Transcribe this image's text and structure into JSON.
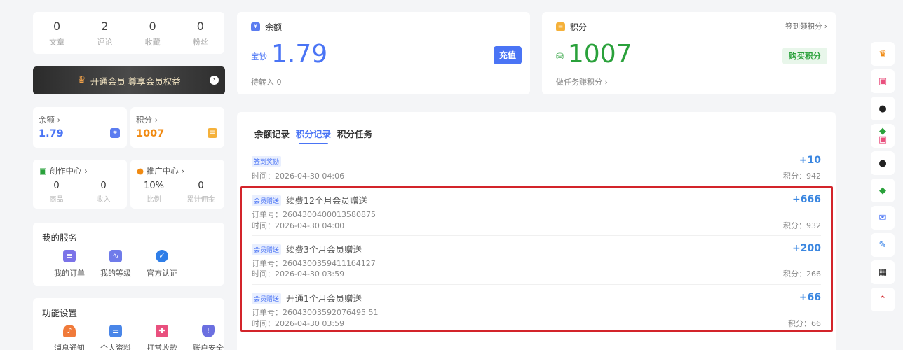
{
  "stats": [
    {
      "value": "0",
      "label": "文章"
    },
    {
      "value": "2",
      "label": "评论"
    },
    {
      "value": "0",
      "label": "收藏"
    },
    {
      "value": "0",
      "label": "粉丝"
    }
  ],
  "vip_banner": {
    "text": "开通会员 尊享会员权益"
  },
  "mini_cards": {
    "balance": {
      "title": "余额 ›",
      "value": "1.79"
    },
    "points": {
      "title": "积分 ›",
      "value": "1007"
    }
  },
  "creator_center": {
    "title": "创作中心 ›",
    "cols": [
      {
        "value": "0",
        "label": "商品"
      },
      {
        "value": "0",
        "label": "收入"
      }
    ]
  },
  "promo_center": {
    "title": "推广中心 ›",
    "cols": [
      {
        "value": "10%",
        "label": "比例"
      },
      {
        "value": "0",
        "label": "累计佣金"
      }
    ]
  },
  "my_services": {
    "title": "我的服务",
    "items": [
      "我的订单",
      "我的等级",
      "官方认证"
    ]
  },
  "settings": {
    "title": "功能设置",
    "items": [
      "消息通知",
      "个人资料",
      "打赏收款",
      "账户安全"
    ]
  },
  "balance_card": {
    "title": "余额",
    "prefix": "宝钞",
    "amount": "1.79",
    "pending": "待转入 0",
    "button": "充值"
  },
  "points_card": {
    "title": "积分",
    "link": "签到领积分 ›",
    "amount": "1007",
    "tasks": "做任务赚积分 ›",
    "button": "购买积分"
  },
  "tabs": [
    "余额记录",
    "积分记录",
    "积分任务"
  ],
  "active_tab": 1,
  "records": [
    {
      "badge": "签到奖励",
      "desc": "",
      "amount": "+10",
      "order": "",
      "time": "时间：2026-04-30 04:06",
      "balance": "积分：942"
    },
    {
      "badge": "会员赠送",
      "desc": "续费12个月会员赠送",
      "amount": "+666",
      "order": "订单号：2604300400013580875",
      "time": "时间：2026-04-30 04:00",
      "balance": "积分：932"
    },
    {
      "badge": "会员赠送",
      "desc": "续费3个月会员赠送",
      "amount": "+200",
      "order": "订单号：26043003594111б4127",
      "time": "时间：2026-04-30 03:59",
      "balance": "积分：266"
    },
    {
      "badge": "会员赠送",
      "desc": "开通1个月会员赠送",
      "amount": "+66",
      "order": "订单号：26043003592076495 51",
      "time": "时间：2026-04-30 03:59",
      "balance": "积分：66"
    }
  ],
  "colors": {
    "accent": "#4a74f5",
    "points_green": "#2aa13b",
    "points_orange": "#f08a12",
    "highlight_red": "#d3242a"
  }
}
